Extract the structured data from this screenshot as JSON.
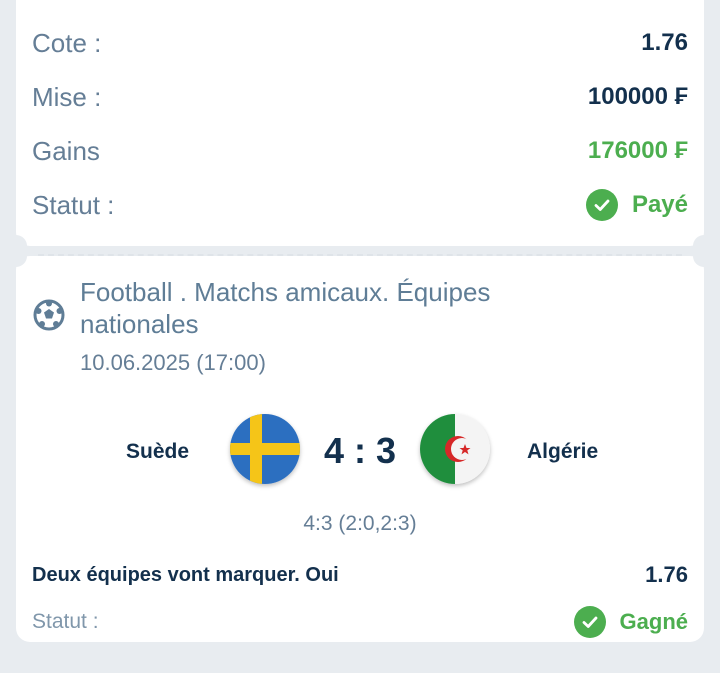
{
  "summary": {
    "cote_label": "Cote :",
    "cote_value": "1.76",
    "mise_label": "Mise :",
    "mise_value": "100000 ₣",
    "gains_label": "Gains",
    "gains_value": "176000 ₣",
    "statut_label": "Statut :",
    "statut_value": "Payé"
  },
  "match": {
    "league": "Football . Matchs amicaux. Équipes nationales",
    "datetime": "10.06.2025 (17:00)",
    "home_team": "Suède",
    "away_team": "Algérie",
    "score": "4 : 3",
    "score_detail": "4:3 (2:0,2:3)",
    "sport_icon": "soccer-ball-icon"
  },
  "bet": {
    "market": "Deux équipes vont marquer. Oui",
    "odds": "1.76",
    "statut_label": "Statut :",
    "statut_value": "Gagné"
  },
  "colors": {
    "green": "#4cae4f",
    "navy": "#13304d",
    "muted": "#657e96",
    "background": "#e8ecf0"
  }
}
